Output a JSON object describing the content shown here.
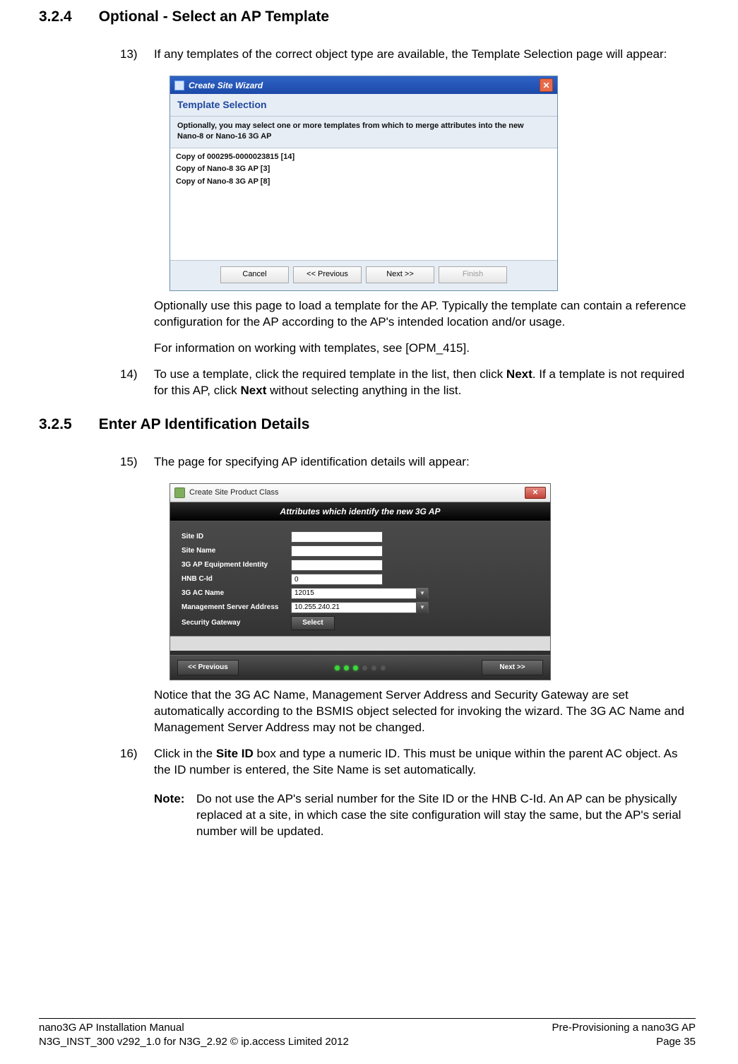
{
  "section324": {
    "num": "3.2.4",
    "title": "Optional - Select an AP Template"
  },
  "section325": {
    "num": "3.2.5",
    "title": "Enter AP Identification Details"
  },
  "step13": {
    "num": "13)",
    "text": "If any templates of the correct object type are available, the Template Selection page will appear:"
  },
  "fig1": {
    "window_title": "Create Site Wizard",
    "sub_title": "Template Selection",
    "desc_l1": "Optionally, you may select one or more templates from which to merge attributes into the new",
    "desc_l2": "Nano-8 or Nano-16 3G AP",
    "items": [
      "Copy of 000295-0000023815 [14]",
      "Copy of Nano-8 3G AP [3]",
      "Copy of Nano-8 3G AP [8]"
    ],
    "btn_cancel": "Cancel",
    "btn_prev": "<< Previous",
    "btn_next": "Next >>",
    "btn_finish": "Finish"
  },
  "after13_p1": "Optionally use this page to load a template for the AP. Typically the template can contain a reference configuration for the AP according to the AP's intended location and/or usage.",
  "after13_p2": "For information on working with templates, see [OPM_415].",
  "step14": {
    "num": "14)",
    "pre": "To use a template, click the required template in the list, then click ",
    "bold1": "Next",
    "mid": ". If a template is not required for this AP, click ",
    "bold2": "Next",
    "post": " without selecting anything in the list."
  },
  "step15": {
    "num": "15)",
    "text": "The page for specifying AP identification details will appear:"
  },
  "fig2": {
    "window_title": "Create Site Product Class",
    "banner": "Attributes which identify the new 3G AP",
    "rows": {
      "site_id": "Site ID",
      "site_name": "Site Name",
      "equip": "3G AP Equipment Identity",
      "hnb": "HNB C-Id",
      "acname": "3G AC Name",
      "msa": "Management Server Address",
      "secgw": "Security Gateway"
    },
    "vals": {
      "hnb": "0",
      "acname": "12015",
      "msa": "10.255.240.21",
      "select": "Select"
    },
    "btn_prev": "<< Previous",
    "btn_next": "Next >>"
  },
  "after15_p1": "Notice that the 3G AC Name, Management Server Address and Security Gateway are set automatically according to the BSMIS object selected for invoking the wizard. The 3G AC Name and Management Server Address may not be changed.",
  "step16": {
    "num": "16)",
    "pre": "Click in the ",
    "bold1": "Site ID",
    "post": " box and type a numeric ID. This must be unique within the parent AC object. As the ID number is entered, the Site Name is set automatically."
  },
  "note16": {
    "label": "Note:",
    "text": "Do not use the AP's serial number for the Site ID or the HNB C-Id. An AP can be physically replaced at a site, in which case the site configuration will stay the same, but the AP's serial number will be updated."
  },
  "footer": {
    "l1": "nano3G AP Installation Manual",
    "l2": "N3G_INST_300 v292_1.0 for N3G_2.92 © ip.access Limited 2012",
    "r1": "Pre-Provisioning a nano3G AP",
    "r2": "Page 35"
  }
}
